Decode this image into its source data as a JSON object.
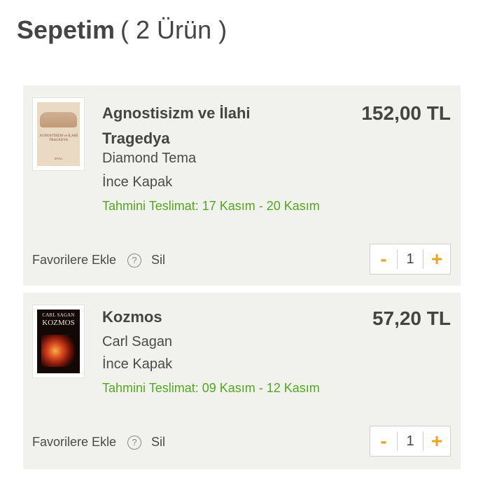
{
  "header": {
    "title": "Sepetim",
    "count": "( 2 Ürün )"
  },
  "cart": {
    "items": [
      {
        "title": "Agnostisizm ve İlahi Tragedya",
        "publisher": "Diamond Tema",
        "binding": "İnce Kapak",
        "delivery": "Tahmini Teslimat: 17 Kasım - 20 Kasım",
        "price": "152,00 TL",
        "favorite_label": "Favorilere Ekle",
        "help_icon": "?",
        "delete_label": "Sil",
        "minus": "-",
        "quantity": "1",
        "plus": "+",
        "cover": {
          "title": "AGNOSTİSİZM ve İLAHİ TRAGEDYA",
          "brand": "DİYAL"
        }
      },
      {
        "title": "Kozmos",
        "publisher": "Carl Sagan",
        "binding": "İnce Kapak",
        "delivery": "Tahmini Teslimat: 09 Kasım - 12 Kasım",
        "price": "57,20 TL",
        "favorite_label": "Favorilere Ekle",
        "help_icon": "?",
        "delete_label": "Sil",
        "minus": "-",
        "quantity": "1",
        "plus": "+",
        "cover": {
          "author": "CARL SAGAN",
          "title": "KOZMOS"
        }
      }
    ]
  },
  "colors": {
    "delivery": "#53a61d",
    "qty_buttons": "#eba329",
    "card_bg": "#f1f2ee"
  }
}
